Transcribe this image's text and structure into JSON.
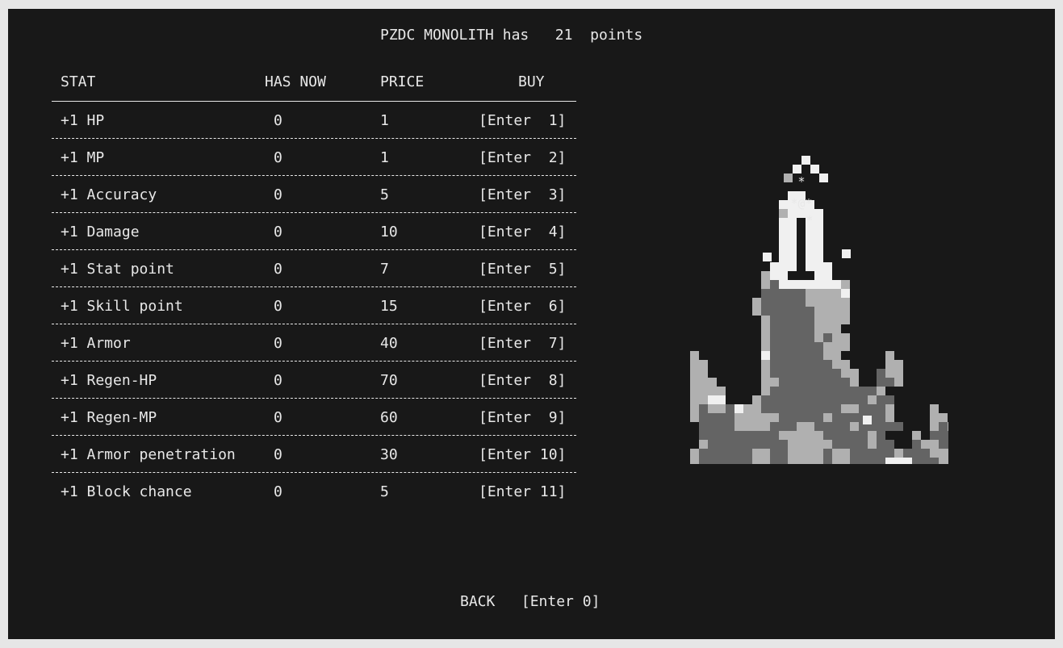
{
  "header": {
    "name": "PZDC MONOLITH",
    "has": "has",
    "points": "21",
    "points_label": "points"
  },
  "table": {
    "columns": [
      "STAT",
      "HAS NOW",
      "PRICE",
      "BUY"
    ],
    "rows": [
      {
        "stat": "+1 HP",
        "has": "0",
        "price": "1",
        "buy": "[Enter  1]"
      },
      {
        "stat": "+1 MP",
        "has": "0",
        "price": "1",
        "buy": "[Enter  2]"
      },
      {
        "stat": "+1 Accuracy",
        "has": "0",
        "price": "5",
        "buy": "[Enter  3]"
      },
      {
        "stat": "+1 Damage",
        "has": "0",
        "price": "10",
        "buy": "[Enter  4]"
      },
      {
        "stat": "+1 Stat point",
        "has": "0",
        "price": "7",
        "buy": "[Enter  5]"
      },
      {
        "stat": "+1 Skill point",
        "has": "0",
        "price": "15",
        "buy": "[Enter  6]"
      },
      {
        "stat": "+1 Armor",
        "has": "0",
        "price": "40",
        "buy": "[Enter  7]"
      },
      {
        "stat": "+1 Regen-HP",
        "has": "0",
        "price": "70",
        "buy": "[Enter  8]"
      },
      {
        "stat": "+1 Regen-MP",
        "has": "0",
        "price": "60",
        "buy": "[Enter  9]"
      },
      {
        "stat": "+1 Armor penetration",
        "has": "0",
        "price": "30",
        "buy": "[Enter 10]"
      },
      {
        "stat": "+1 Block chance",
        "has": "0",
        "price": "5",
        "buy": "[Enter 11]"
      }
    ]
  },
  "footer": {
    "back_label": "BACK",
    "back_key": "[Enter 0]"
  },
  "art": {
    "glyph_top": "*",
    "glyph_mid": "*@*",
    "glyph_bot": "*"
  },
  "colors": {
    "background": "#181818",
    "text": "#e8e8e8",
    "art_light": "#f0f0f0",
    "art_mid": "#b0b0b0",
    "art_dark": "#646464"
  }
}
